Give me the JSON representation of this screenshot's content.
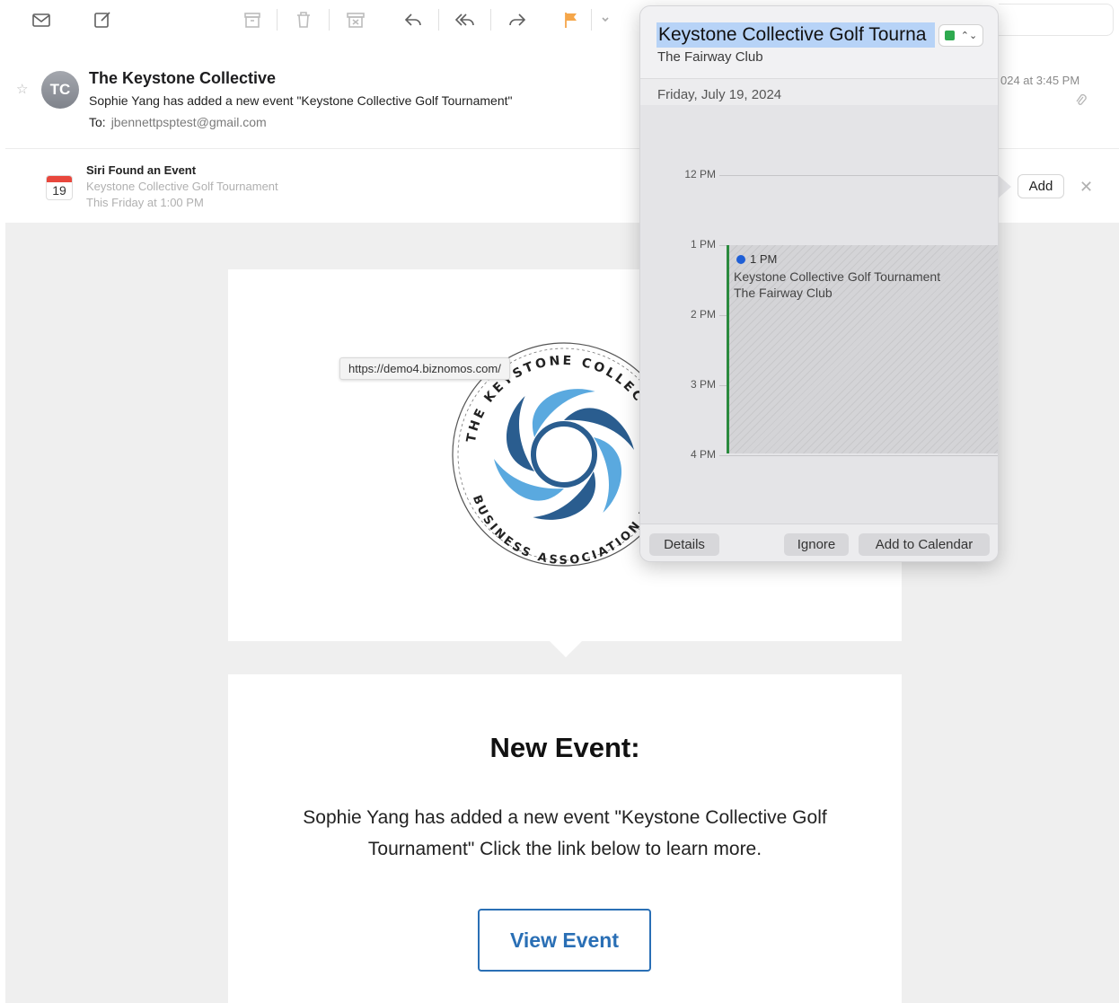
{
  "toolbar": {
    "icons": [
      "envelope-icon",
      "compose-icon",
      "archive-icon",
      "trash-icon",
      "junk-icon",
      "reply-icon",
      "reply-all-icon",
      "forward-icon",
      "flag-icon",
      "chevron-down-icon"
    ]
  },
  "message": {
    "avatar_initials": "TC",
    "sender": "The Keystone Collective",
    "subject": "Sophie Yang has added a new event \"Keystone Collective Golf Tournament\"",
    "to_label": "To:",
    "to_address": "jbennettpsptest@gmail.com",
    "date_partial": "024 at 3:45 PM"
  },
  "siri": {
    "calendar_day": "19",
    "title": "Siri Found an Event",
    "event_name": "Keystone Collective Golf Tournament",
    "event_when": "This Friday at 1:00 PM",
    "add_label": "Add"
  },
  "body": {
    "logo_text_top": "THE KEYSTONE COLLECTIVE",
    "logo_text_bottom": "BUSINESS ASSOCIATION NE",
    "url_tooltip": "https://demo4.biznomos.com/",
    "heading": "New Event:",
    "text": "Sophie Yang has added a new event \"Keystone Collective Golf Tournament\" Click the link below to learn more.",
    "button_label": "View Event"
  },
  "popover": {
    "title": "Keystone Collective Golf Tourna",
    "calendar_color": "#2eaa4f",
    "location": "The Fairway Club",
    "date": "Friday, July 19, 2024",
    "hours": [
      "12 PM",
      "1 PM",
      "2 PM",
      "3 PM",
      "4 PM"
    ],
    "event": {
      "time": "1 PM",
      "name": "Keystone Collective Golf Tournament",
      "place": "The Fairway Club"
    },
    "buttons": {
      "details": "Details",
      "ignore": "Ignore",
      "add": "Add to Calendar"
    }
  },
  "colors": {
    "accent_blue": "#2a6fb5",
    "logo_dark_blue": "#2a5d8f",
    "logo_light_blue": "#5aa9df",
    "flag_orange": "#f5a64a"
  }
}
